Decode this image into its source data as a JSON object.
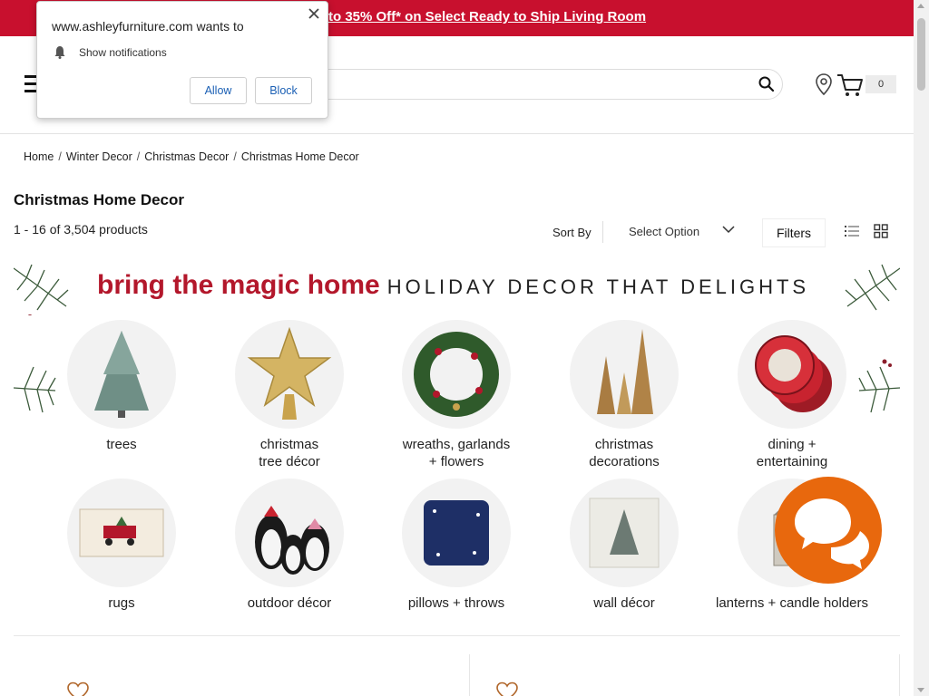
{
  "promo": {
    "text": "to 35% Off* on Select Ready to Ship Living Room"
  },
  "header": {
    "search_placeholder": "",
    "cart_count": "0"
  },
  "breadcrumb": [
    "Home",
    "Winter Decor",
    "Christmas Decor",
    "Christmas Home Decor"
  ],
  "page": {
    "title": "Christmas Home Decor",
    "result_count": "1 - 16 of 3,504 products"
  },
  "toolbar": {
    "sort_label": "Sort By",
    "sort_value": "Select Option",
    "filters_label": "Filters"
  },
  "banner": {
    "accent": "bring the magic home",
    "tagline": "HOLIDAY DECOR THAT DELIGHTS"
  },
  "categories": [
    {
      "line1": "trees",
      "line2": "",
      "icon": "christmas-tree"
    },
    {
      "line1": "christmas",
      "line2": "tree décor",
      "icon": "star-topper"
    },
    {
      "line1": "wreaths, garlands",
      "line2": "+ flowers",
      "icon": "wreath"
    },
    {
      "line1": "christmas",
      "line2": "decorations",
      "icon": "cone-trees"
    },
    {
      "line1": "dining +",
      "line2": "entertaining",
      "icon": "plates"
    },
    {
      "line1": "rugs",
      "line2": "",
      "icon": "rug"
    },
    {
      "line1": "outdoor décor",
      "line2": "",
      "icon": "penguins"
    },
    {
      "line1": "pillows + throws",
      "line2": "",
      "icon": "pillow"
    },
    {
      "line1": "wall décor",
      "line2": "",
      "icon": "wall-sign"
    },
    {
      "line1": "lanterns + candle holders",
      "line2": "",
      "icon": "lantern"
    }
  ],
  "notification": {
    "title": "www.ashleyfurniture.com wants to",
    "permission": "Show notifications",
    "allow": "Allow",
    "block": "Block"
  },
  "colors": {
    "brand_red": "#c8102e",
    "chat_orange": "#e8680d",
    "link_blue": "#1a5fb4"
  }
}
